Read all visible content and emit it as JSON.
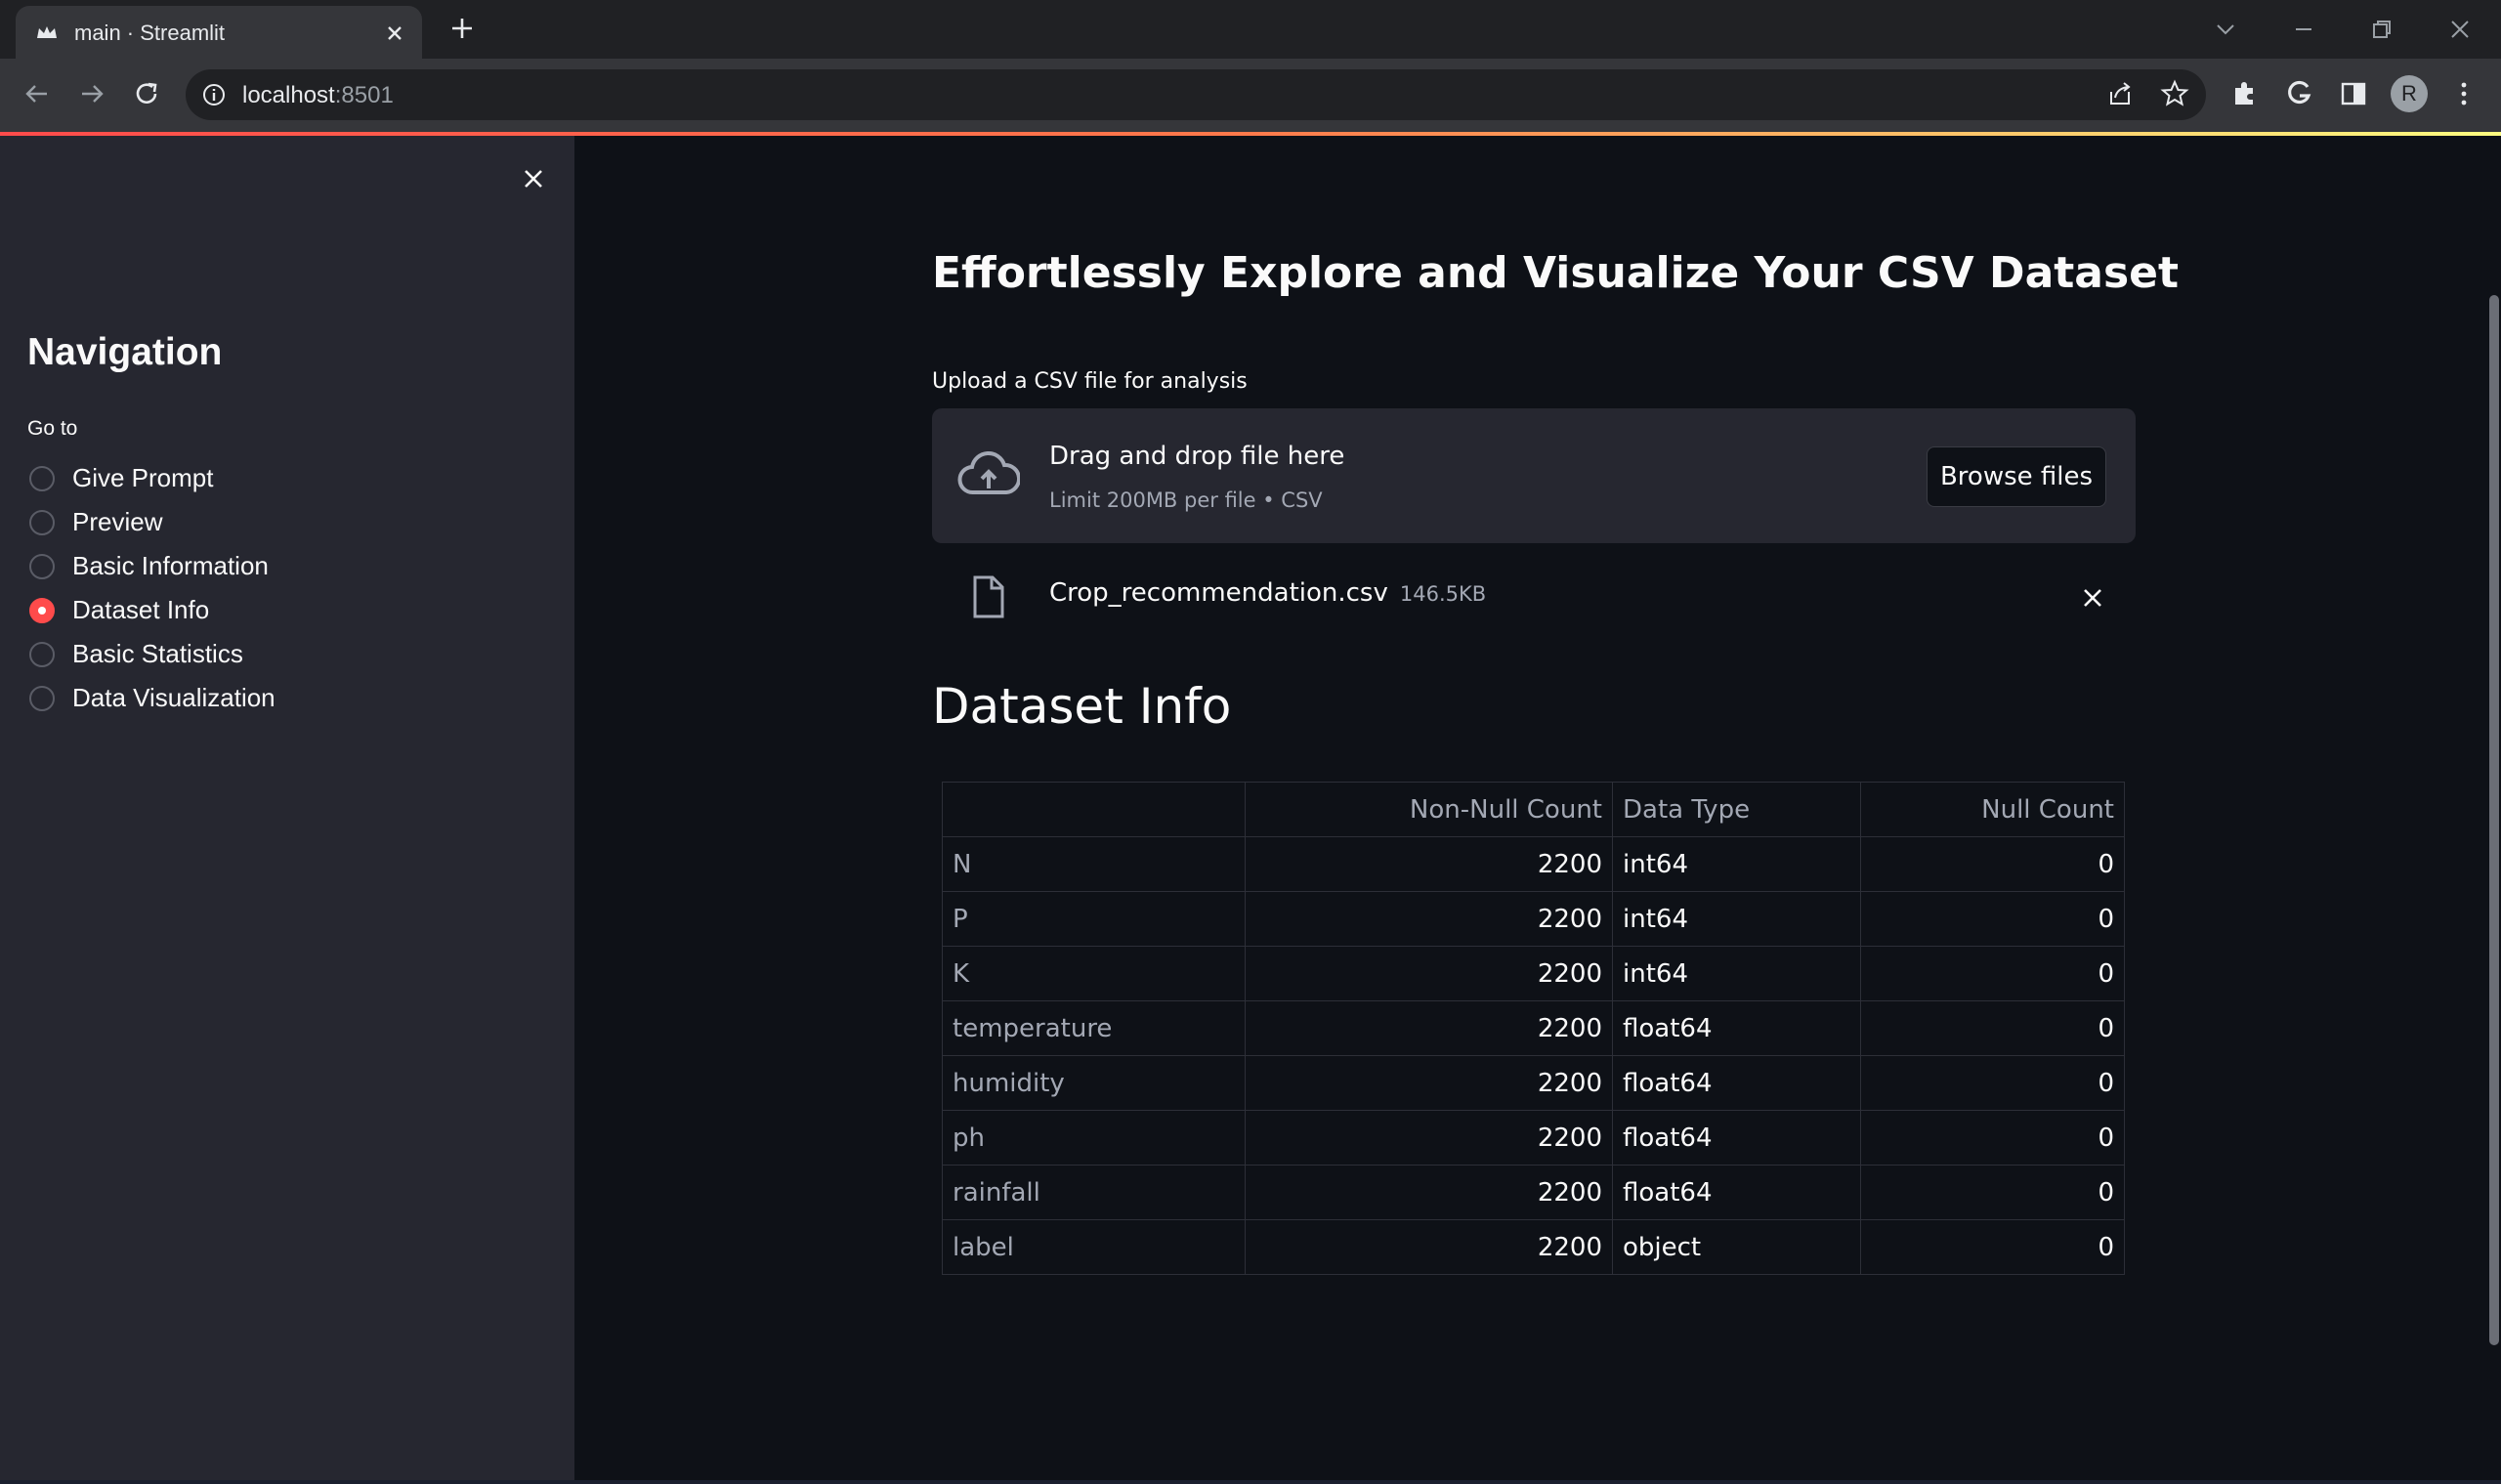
{
  "browser": {
    "tab_title": "main · Streamlit",
    "url_host": "localhost",
    "url_port": ":8501",
    "avatar_letter": "R"
  },
  "sidebar": {
    "title": "Navigation",
    "radio_label": "Go to",
    "options": [
      {
        "label": "Give Prompt",
        "selected": false
      },
      {
        "label": "Preview",
        "selected": false
      },
      {
        "label": "Basic Information",
        "selected": false
      },
      {
        "label": "Dataset Info",
        "selected": true
      },
      {
        "label": "Basic Statistics",
        "selected": false
      },
      {
        "label": "Data Visualization",
        "selected": false
      }
    ]
  },
  "main": {
    "title": "Effortlessly Explore and Visualize Your CSV Dataset",
    "uploader": {
      "label": "Upload a CSV file for analysis",
      "drop_text": "Drag and drop file here",
      "limit_text": "Limit 200MB per file • CSV",
      "browse_label": "Browse files"
    },
    "file": {
      "name": "Crop_recommendation.csv",
      "size": "146.5KB"
    },
    "section_title": "Dataset Info",
    "table": {
      "columns": [
        "",
        "Non-Null Count",
        "Data Type",
        "Null Count"
      ],
      "rows": [
        {
          "index": "N",
          "non_null": "2200",
          "dtype": "int64",
          "null": "0"
        },
        {
          "index": "P",
          "non_null": "2200",
          "dtype": "int64",
          "null": "0"
        },
        {
          "index": "K",
          "non_null": "2200",
          "dtype": "int64",
          "null": "0"
        },
        {
          "index": "temperature",
          "non_null": "2200",
          "dtype": "float64",
          "null": "0"
        },
        {
          "index": "humidity",
          "non_null": "2200",
          "dtype": "float64",
          "null": "0"
        },
        {
          "index": "ph",
          "non_null": "2200",
          "dtype": "float64",
          "null": "0"
        },
        {
          "index": "rainfall",
          "non_null": "2200",
          "dtype": "float64",
          "null": "0"
        },
        {
          "index": "label",
          "non_null": "2200",
          "dtype": "object",
          "null": "0"
        }
      ]
    }
  },
  "colors": {
    "accent": "#ff4b4b",
    "background": "#0e1117",
    "sidebar": "#262730"
  }
}
